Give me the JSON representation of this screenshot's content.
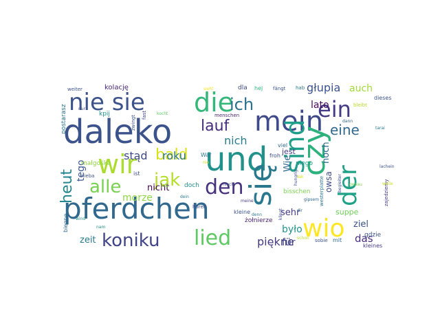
{
  "words": [
    {
      "text": "daleko",
      "color": "#3b528b"
    },
    {
      "text": "und",
      "color": "#21918c"
    },
    {
      "text": "pferdchen",
      "color": "#31688e"
    },
    {
      "text": "nie sie",
      "color": "#3b528b"
    },
    {
      "text": "die",
      "color": "#35b779"
    },
    {
      "text": "mein",
      "color": "#3e4a89"
    },
    {
      "text": "ein",
      "color": "#443a83"
    },
    {
      "text": "czy",
      "color": "#2db27d"
    },
    {
      "text": "sind",
      "color": "#1f9e89"
    },
    {
      "text": "się",
      "color": "#2a788e"
    },
    {
      "text": "wir",
      "color": "#addc30"
    },
    {
      "text": "den",
      "color": "#46327e"
    },
    {
      "text": "der",
      "color": "#1fa187"
    },
    {
      "text": "wio",
      "color": "#fde725"
    },
    {
      "text": "koniku",
      "color": "#414487"
    },
    {
      "text": "lied",
      "color": "#5ec962"
    },
    {
      "text": "alle",
      "color": "#7ad151"
    },
    {
      "text": "jak",
      "color": "#b5de2b"
    },
    {
      "text": "ich",
      "color": "#2c728e"
    },
    {
      "text": "lauf",
      "color": "#472d7b"
    },
    {
      "text": "bald",
      "color": "#d8e219"
    },
    {
      "text": "heut",
      "color": "#25848e"
    },
    {
      "text": "eine",
      "color": "#31688e"
    },
    {
      "text": "głupia",
      "color": "#3b528b"
    },
    {
      "text": "auch",
      "color": "#a0da39"
    },
    {
      "text": "lato",
      "color": "#46085c"
    },
    {
      "text": "stąd",
      "color": "#3e4a89"
    },
    {
      "text": "roku",
      "color": "#2a788e"
    },
    {
      "text": "nich",
      "color": "#287c8e"
    },
    {
      "text": "tego",
      "color": "#39568c"
    },
    {
      "text": "morze",
      "color": "#8fd744"
    },
    {
      "text": "nicht",
      "color": "#440154"
    },
    {
      "text": "sehr",
      "color": "#443a83"
    },
    {
      "text": "było",
      "color": "#21918c"
    },
    {
      "text": "noch",
      "color": "#31688e"
    },
    {
      "text": "owsa",
      "color": "#3e4a89"
    },
    {
      "text": "suppe",
      "color": "#6ece58"
    },
    {
      "text": "ziel",
      "color": "#3b528b"
    },
    {
      "text": "das",
      "color": "#472d7b"
    },
    {
      "text": "zeit",
      "color": "#2a788e"
    },
    {
      "text": "für",
      "color": "#3e4a89"
    },
    {
      "text": "piękne",
      "color": "#443a83"
    },
    {
      "text": "Wie",
      "color": "#31688e"
    },
    {
      "text": "jest",
      "color": "#443a83"
    },
    {
      "text": "niego",
      "color": "#1f9e89"
    },
    {
      "text": "bisschen",
      "color": "#7ad151"
    },
    {
      "text": "kolację",
      "color": "#482677"
    },
    {
      "text": "dla",
      "color": "#3e4a89"
    },
    {
      "text": "hej",
      "color": "#2db27d"
    },
    {
      "text": "fängt",
      "color": "#3b528b"
    },
    {
      "text": "hab",
      "color": "#2a788e"
    },
    {
      "text": "dieses",
      "color": "#3b528b"
    },
    {
      "text": "bleibt",
      "color": "#b5de2b"
    },
    {
      "text": "weiter",
      "color": "#3b528b"
    },
    {
      "text": "postarasz",
      "color": "#2c728e"
    },
    {
      "text": "kpij",
      "color": "#21918c"
    },
    {
      "text": "małgośka",
      "color": "#90d743"
    },
    {
      "text": "ist",
      "color": "#3e4a89"
    },
    {
      "text": "fast",
      "color": "#414487"
    },
    {
      "text": "kocht",
      "color": "#5ec962"
    },
    {
      "text": "menschen",
      "color": "#482677"
    },
    {
      "text": "War",
      "color": "#2a788e"
    },
    {
      "text": "nie",
      "color": "#c2df23"
    },
    {
      "text": "froh",
      "color": "#3e4a89"
    },
    {
      "text": "viel",
      "color": "#31688e"
    },
    {
      "text": "nieba",
      "color": "#3b528b"
    },
    {
      "text": "już",
      "color": "#8fd744"
    },
    {
      "text": "doch",
      "color": "#21918c"
    },
    {
      "text": "dein",
      "color": "#2a788e"
    },
    {
      "text": "hungrig",
      "color": "#3e4a89"
    },
    {
      "text": "żołnierze",
      "color": "#481f70"
    },
    {
      "text": "westerplatte",
      "color": "#2c728e"
    },
    {
      "text": "zajedziemy",
      "color": "#443a83"
    },
    {
      "text": "dir",
      "color": "#31688e"
    },
    {
      "text": "biegnę",
      "color": "#31688e"
    },
    {
      "text": "wind",
      "color": "#21918c"
    },
    {
      "text": "hören",
      "color": "#3e4a89"
    },
    {
      "text": "kleine",
      "color": "#3b528b"
    },
    {
      "text": "meine",
      "color": "#443a83"
    },
    {
      "text": "klingt",
      "color": "#3e4a89"
    },
    {
      "text": "gdzie",
      "color": "#3b528b"
    },
    {
      "text": "nam",
      "color": "#21918c"
    },
    {
      "text": "denn",
      "color": "#2a788e"
    },
    {
      "text": "sobie",
      "color": "#3b528b"
    },
    {
      "text": "mit",
      "color": "#31688e"
    },
    {
      "text": "kleines",
      "color": "#443a83"
    },
    {
      "text": "lachein",
      "color": "#3b528b"
    },
    {
      "text": "genau",
      "color": "#7ad151"
    },
    {
      "text": "dann",
      "color": "#31688e"
    },
    {
      "text": "zwingt",
      "color": "#3b528b"
    },
    {
      "text": "nur",
      "color": "#3e4a89"
    },
    {
      "text": "sieht",
      "color": "#fde725"
    },
    {
      "text": "tak",
      "color": "#d8e219"
    },
    {
      "text": "weile",
      "color": "#c2df23"
    },
    {
      "text": "schon",
      "color": "#b5de2b"
    },
    {
      "text": "tarai",
      "color": "#2a788e"
    },
    {
      "text": "begleiter",
      "color": "#3b528b"
    },
    {
      "text": "niech",
      "color": "#3e4a89"
    },
    {
      "text": "gipsem",
      "color": "#31688e"
    }
  ]
}
